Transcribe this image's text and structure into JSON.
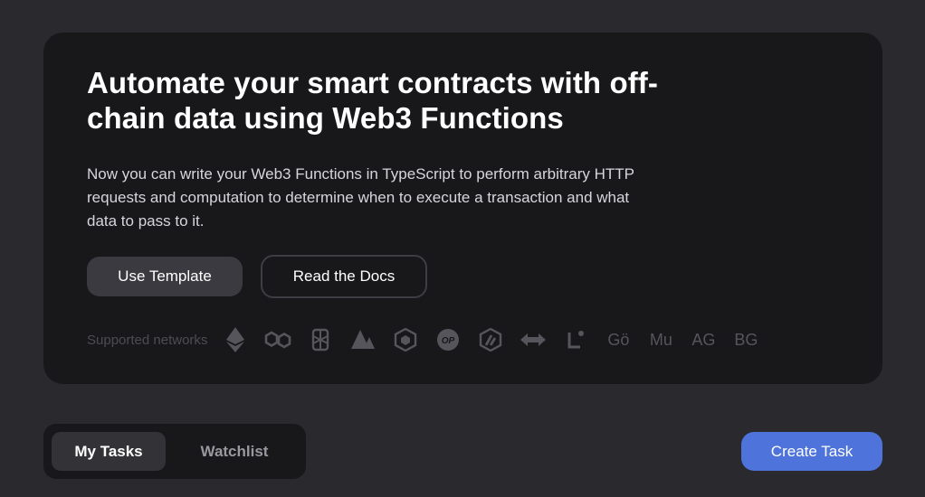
{
  "hero": {
    "title": "Automate your smart contracts with off-chain data using Web3 Functions",
    "description": "Now you can write your Web3 Functions in TypeScript to perform arbitrary HTTP requests and computation to determine when to execute a transaction and what data to pass to it.",
    "use_template_label": "Use Template",
    "read_docs_label": "Read the Docs"
  },
  "networks": {
    "label": "Supported networks",
    "icons": [
      "ethereum-icon",
      "polygon-icon",
      "fantom-icon",
      "avalanche-icon",
      "bnb-chain-icon",
      "optimism-icon",
      "arbitrum-icon",
      "gnosis-icon",
      "linea-icon"
    ],
    "abbreviations": [
      "Gö",
      "Mu",
      "AG",
      "BG"
    ]
  },
  "tabs": {
    "my_tasks": "My Tasks",
    "watchlist": "Watchlist",
    "active": "my_tasks"
  },
  "actions": {
    "create_task": "Create Task"
  },
  "colors": {
    "background": "#2a292e",
    "card": "#18181b",
    "accent": "#4e74dc",
    "muted_icon": "#55555b"
  }
}
